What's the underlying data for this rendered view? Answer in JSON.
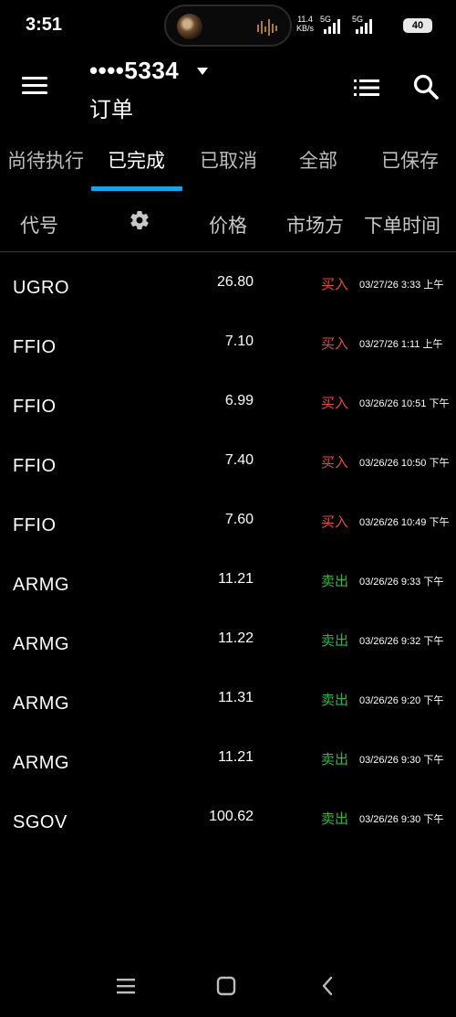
{
  "status_bar": {
    "time": "3:51",
    "net_speed_value": "11.4",
    "net_speed_unit": "KB/s",
    "signal1_label": "5G",
    "signal2_label": "5G",
    "battery": "40"
  },
  "header": {
    "account": "••••5334",
    "title": "订单"
  },
  "tabs": [
    {
      "label": "尚待执行",
      "active": false
    },
    {
      "label": "已完成",
      "active": true
    },
    {
      "label": "已取消",
      "active": false
    },
    {
      "label": "全部",
      "active": false
    },
    {
      "label": "已保存",
      "active": false
    }
  ],
  "columns": {
    "symbol": "代号",
    "price": "价格",
    "side": "市场方",
    "time": "下单时间"
  },
  "orders": [
    {
      "symbol": "UGRO",
      "price": "26.80",
      "side": "买入",
      "side_type": "buy",
      "time": "03/27/26 3:33 上午"
    },
    {
      "symbol": "FFIO",
      "price": "7.10",
      "side": "买入",
      "side_type": "buy",
      "time": "03/27/26 1:11 上午"
    },
    {
      "symbol": "FFIO",
      "price": "6.99",
      "side": "买入",
      "side_type": "buy",
      "time": "03/26/26 10:51 下午"
    },
    {
      "symbol": "FFIO",
      "price": "7.40",
      "side": "买入",
      "side_type": "buy",
      "time": "03/26/26 10:50 下午"
    },
    {
      "symbol": "FFIO",
      "price": "7.60",
      "side": "买入",
      "side_type": "buy",
      "time": "03/26/26 10:49 下午"
    },
    {
      "symbol": "ARMG",
      "price": "11.21",
      "side": "卖出",
      "side_type": "sell",
      "time": "03/26/26 9:33 下午"
    },
    {
      "symbol": "ARMG",
      "price": "11.22",
      "side": "卖出",
      "side_type": "sell",
      "time": "03/26/26 9:32 下午"
    },
    {
      "symbol": "ARMG",
      "price": "11.31",
      "side": "卖出",
      "side_type": "sell",
      "time": "03/26/26 9:20 下午"
    },
    {
      "symbol": "ARMG",
      "price": "11.21",
      "side": "卖出",
      "side_type": "sell",
      "time": "03/26/26 9:30 下午"
    },
    {
      "symbol": "SGOV",
      "price": "100.62",
      "side": "卖出",
      "side_type": "sell",
      "time": "03/26/26 9:30 下午"
    }
  ],
  "colors": {
    "buy": "#e24b4b",
    "sell": "#33b54a",
    "accent": "#1aa3e8"
  },
  "icons": {
    "menu": "hamburger-icon",
    "list": "list-icon",
    "search": "search-icon",
    "settings": "gear-icon",
    "nav_recents": "recents-icon",
    "nav_home": "home-icon",
    "nav_back": "back-icon"
  }
}
